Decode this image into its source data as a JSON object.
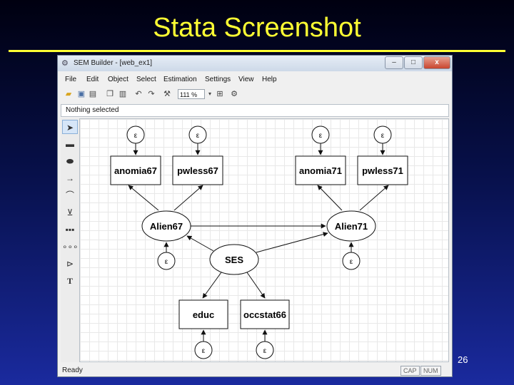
{
  "slide": {
    "title": "Stata Screenshot",
    "page_number": "26",
    "title_color": "#ffff33"
  },
  "window": {
    "title": "SEM Builder - [web_ex1]",
    "controls": {
      "minimize": "–",
      "maximize": "□",
      "close": "x"
    }
  },
  "menu": [
    "File",
    "Edit",
    "Object",
    "Select",
    "Estimation",
    "Settings",
    "View",
    "Help"
  ],
  "toolbar": {
    "zoom": "111 %",
    "icons": [
      "open-icon",
      "save-icon",
      "print-icon",
      "copy-icon",
      "paste-icon",
      "undo-icon",
      "redo-icon",
      "estimate-icon",
      "zoom-dropdown-icon",
      "fit-icon",
      "settings-icon"
    ]
  },
  "status_line": "Nothing selected",
  "tools": [
    "select-tool-icon",
    "observed-variable-tool-icon",
    "latent-variable-tool-icon",
    "path-tool-icon",
    "covariance-tool-icon",
    "measurement-component-tool-icon",
    "regression-component-tool-icon",
    "multi-variable-tool-icon",
    "group-tool-icon",
    "text-tool-icon"
  ],
  "diagram": {
    "observed": {
      "anomia67": "anomia67",
      "pwless67": "pwless67",
      "anomia71": "anomia71",
      "pwless71": "pwless71",
      "educ": "educ",
      "occstat66": "occstat66"
    },
    "latent": {
      "alien67": "Alien67",
      "alien71": "Alien71",
      "ses": "SES"
    },
    "error_label": "ε"
  },
  "statusbar": {
    "ready": "Ready",
    "cap": "CAP",
    "num": "NUM"
  }
}
